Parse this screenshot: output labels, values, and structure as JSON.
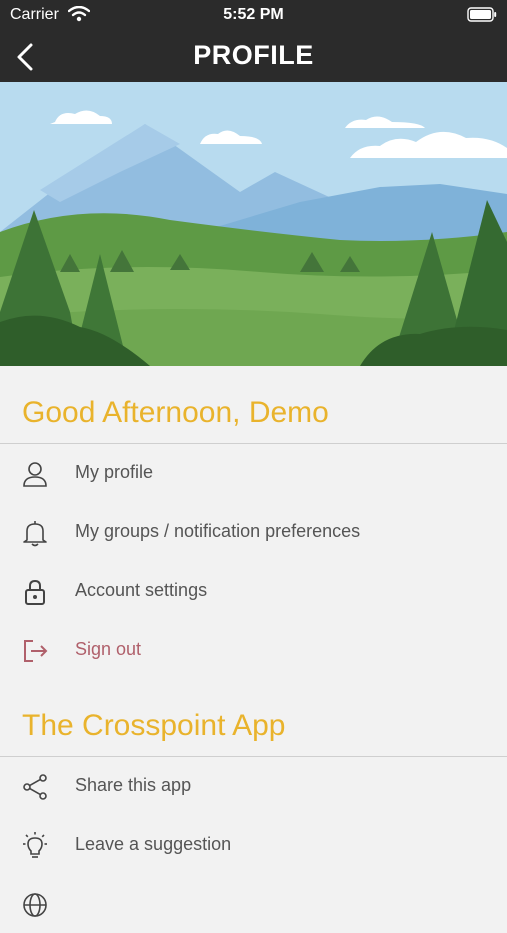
{
  "status_bar": {
    "carrier": "Carrier",
    "time": "5:52 PM"
  },
  "nav": {
    "title": "PROFILE"
  },
  "greeting": "Good Afternoon, Demo",
  "account_menu": [
    {
      "label": "My profile",
      "icon": "person-icon"
    },
    {
      "label": "My groups / notification preferences",
      "icon": "bell-icon"
    },
    {
      "label": "Account settings",
      "icon": "lock-icon"
    },
    {
      "label": "Sign out",
      "icon": "sign-out-icon"
    }
  ],
  "app_section_title": "The Crosspoint App",
  "app_menu": [
    {
      "label": "Share this app",
      "icon": "share-icon"
    },
    {
      "label": "Leave a suggestion",
      "icon": "lightbulb-icon"
    },
    {
      "label": "",
      "icon": "globe-icon"
    }
  ],
  "colors": {
    "accent": "#e9b32c",
    "header_bg": "#2b2b2b",
    "sign_out": "#b0606b"
  }
}
